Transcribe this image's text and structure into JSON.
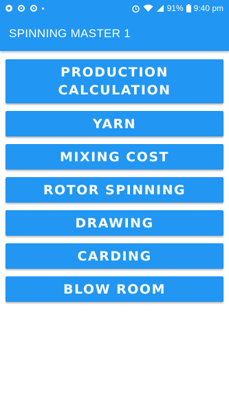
{
  "status_bar": {
    "battery": "91%",
    "time": "9:40 pm",
    "left_icons": [
      "notification-icon",
      "settings-icon",
      "settings-icon-2",
      "dot"
    ],
    "right_icons": [
      "alarm-icon",
      "wifi-icon",
      "signal-icon",
      "battery-icon"
    ]
  },
  "app_bar": {
    "title": "SPINNING MASTER 1"
  },
  "menu": {
    "items": [
      {
        "line1": "PRODUCTION",
        "line2": "CALCULATION"
      },
      {
        "label": "YARN"
      },
      {
        "label": "MIXING COST"
      },
      {
        "label": "ROTOR SPINNING"
      },
      {
        "label": "DRAWING"
      },
      {
        "label": "CARDING"
      },
      {
        "label": "BLOW ROOM"
      }
    ]
  },
  "colors": {
    "primary": "#2196f3",
    "text_on_primary": "#ffffff",
    "background": "#ffffff"
  }
}
